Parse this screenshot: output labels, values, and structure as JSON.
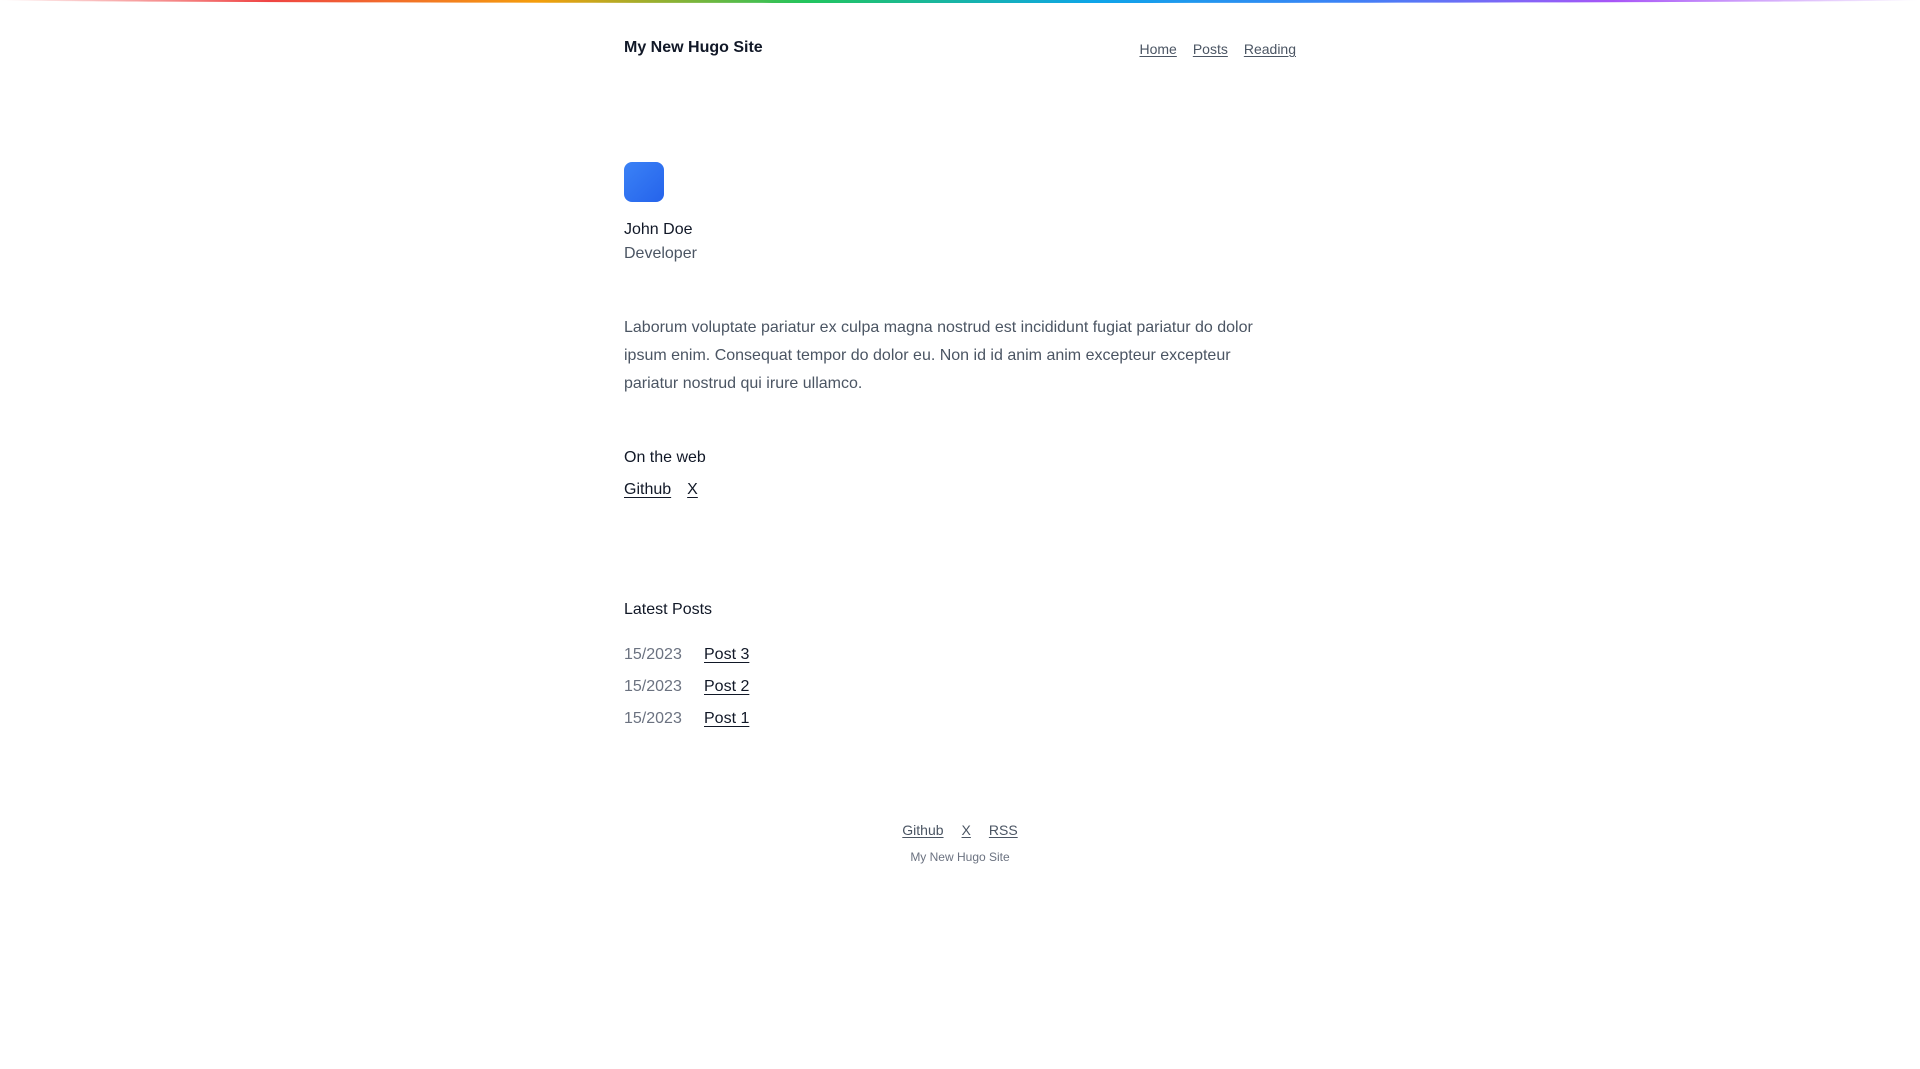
{
  "site_title": "My New Hugo Site",
  "nav": {
    "home": "Home",
    "posts": "Posts",
    "reading": "Reading"
  },
  "profile": {
    "name": "John Doe",
    "role": "Developer",
    "avatar_color": "#2563eb",
    "bio": "Laborum voluptate pariatur ex culpa magna nostrud est incididunt fugiat pariatur do dolor ipsum enim. Consequat tempor do dolor eu. Non id id anim anim excepteur excepteur pariatur nostrud qui irure ullamco."
  },
  "web": {
    "heading": "On the web",
    "links": [
      "Github",
      "X"
    ]
  },
  "latest": {
    "heading": "Latest Posts",
    "posts": [
      {
        "date": "15/2023",
        "title": "Post 3"
      },
      {
        "date": "15/2023",
        "title": "Post 2"
      },
      {
        "date": "15/2023",
        "title": "Post 1"
      }
    ]
  },
  "footer": {
    "links": [
      "Github",
      "X",
      "RSS"
    ],
    "copyright": "My New Hugo Site"
  }
}
